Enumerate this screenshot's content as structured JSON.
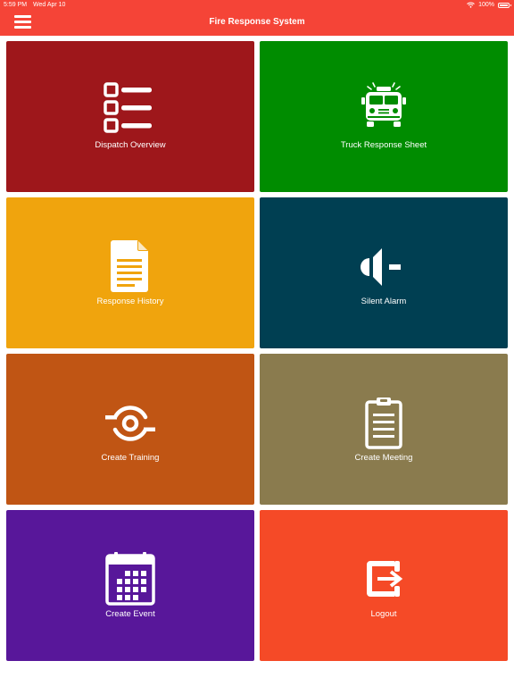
{
  "status_bar": {
    "time": "5:59 PM",
    "date": "Wed Apr 10",
    "battery": "100%"
  },
  "header": {
    "title": "Fire Response System",
    "menu_icon": "hamburger-menu-icon"
  },
  "tiles": [
    {
      "label": "Dispatch Overview",
      "icon": "checklist-icon",
      "color": "#9e171b"
    },
    {
      "label": "Truck Response Sheet",
      "icon": "fire-truck-icon",
      "color": "#008c00"
    },
    {
      "label": "Response History",
      "icon": "document-icon",
      "color": "#f0a40d"
    },
    {
      "label": "Silent Alarm",
      "icon": "speaker-muted-icon",
      "color": "#003f52"
    },
    {
      "label": "Create Training",
      "icon": "training-target-icon",
      "color": "#c05514"
    },
    {
      "label": "Create Meeting",
      "icon": "clipboard-icon",
      "color": "#8a7b4e"
    },
    {
      "label": "Create Event",
      "icon": "calendar-icon",
      "color": "#58179a"
    },
    {
      "label": "Logout",
      "icon": "logout-icon",
      "color": "#f54a27"
    }
  ],
  "colors": {
    "header": "#f54437",
    "background": "#ffffff"
  }
}
